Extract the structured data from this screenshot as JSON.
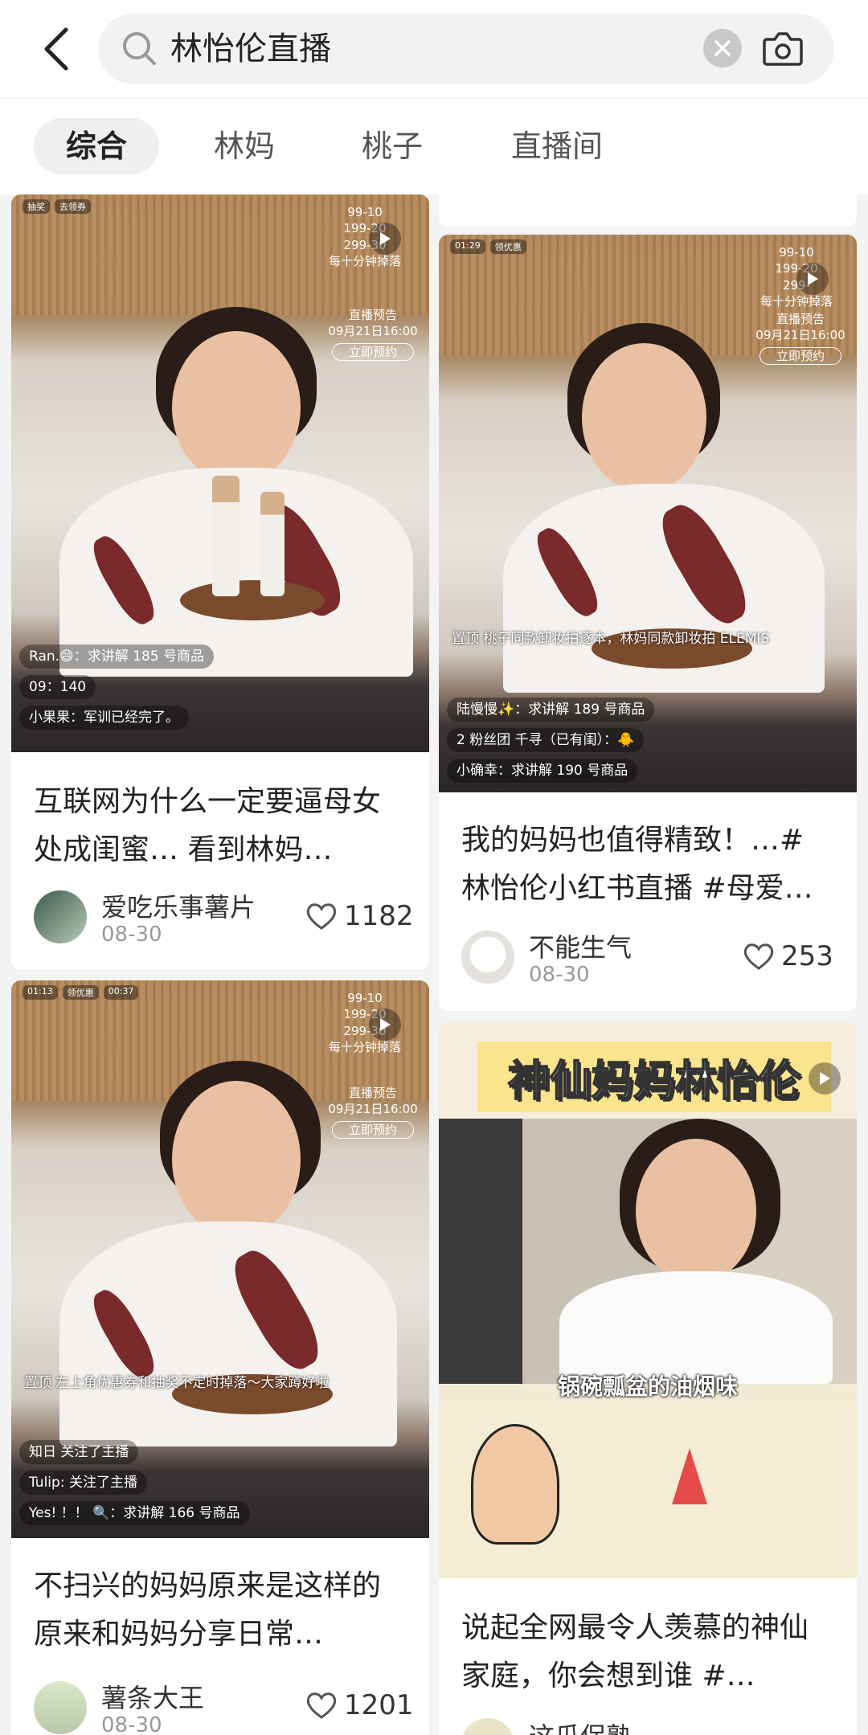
{
  "search": {
    "query": "林怡伦直播"
  },
  "tabs": [
    "综合",
    "林妈",
    "桃子",
    "直播间"
  ],
  "cards": [
    {
      "title": "互联网为什么一定要逼母女处成闺蜜… 看到林妈…",
      "author": "爱吃乐事薯片",
      "date": "08-30",
      "likes": "1182",
      "promo": [
        "99-10",
        "199-20",
        "299-30",
        "每十分钟掉落"
      ],
      "preview": [
        "直播预告",
        "09月21日16:00",
        "立即预约"
      ],
      "badges": [
        "抽奖",
        "去领券"
      ],
      "comments": [
        "Ran.😄：求讲解 185 号商品",
        "09：140",
        "小果果：军训已经完了。"
      ]
    },
    {
      "title": "我的妈妈也值得精致！…# 林怡伦小红书直播 #母爱…",
      "author": "不能生气",
      "date": "08-30",
      "likes": "253",
      "promo": [
        "99-10",
        "199-20",
        "299-",
        "每十分钟掉落"
      ],
      "preview": [
        "直播预告",
        "09月21日16:00",
        "立即预约"
      ],
      "badges": [
        "01:29",
        "领优惠"
      ],
      "pinned": "置顶 桃子同款卸妆拍逐本，林妈同款卸妆拍 ELEMIS",
      "comments": [
        "陆慢慢✨：求讲解 189 号商品",
        "2 粉丝团 千寻（已有闺）：🐥",
        "小确幸：求讲解 190 号商品"
      ]
    },
    {
      "title": "不扫兴的妈妈原来是这样的 原来和妈妈分享日常…",
      "author": "薯条大王",
      "date": "08-30",
      "likes": "1201",
      "promo": [
        "99-10",
        "199-20",
        "299-30",
        "每十分钟掉落"
      ],
      "preview": [
        "直播预告",
        "09月21日16:00",
        "立即预约"
      ],
      "badges": [
        "01:13",
        "领优惠",
        "00:37"
      ],
      "pinned": "置顶 左上角优惠券和抽奖不定时掉落～大家蹲好啦",
      "comments": [
        "知日 关注了主播",
        "Tulip: 关注了主播",
        "Yes! ！！ 🔍：求讲解 166 号商品"
      ]
    },
    {
      "title": "说起全网最令人羡慕的神仙家庭，你会想到谁 #…",
      "author": "这瓜保熟",
      "date": "",
      "likes": "",
      "banner": "神仙妈妈林怡伦",
      "subtitle": "锅碗瓢盆的油烟味"
    }
  ]
}
